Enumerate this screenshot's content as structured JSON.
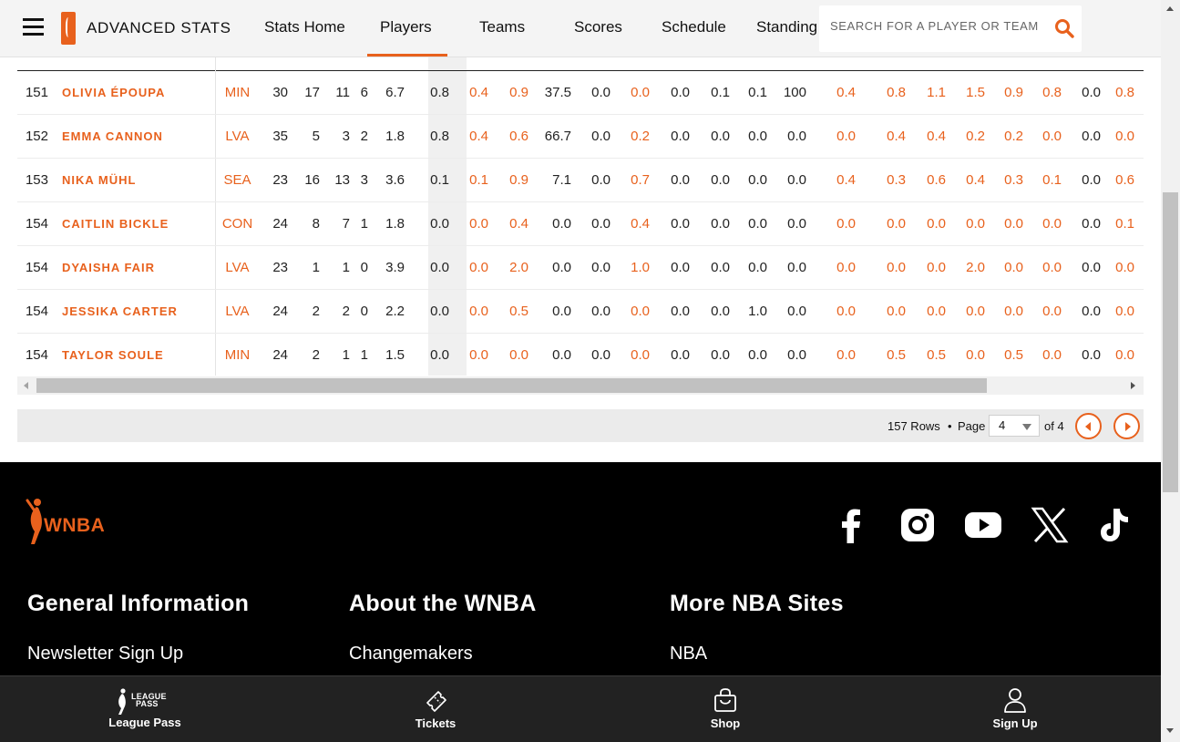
{
  "header": {
    "title": "ADVANCED STATS",
    "nav": [
      {
        "label": "Stats Home",
        "name": "nav-stats-home"
      },
      {
        "label": "Players",
        "name": "nav-players"
      },
      {
        "label": "Teams",
        "name": "nav-teams"
      },
      {
        "label": "Scores",
        "name": "nav-scores"
      },
      {
        "label": "Schedule",
        "name": "nav-schedule"
      },
      {
        "label": "Standing",
        "name": "nav-standings"
      }
    ],
    "active_nav": "Players",
    "search_placeholder": "SEARCH FOR A PLAYER OR TEAM"
  },
  "colors": {
    "accent": "#e8611d",
    "footer_bg": "#000000",
    "bottom_bar_bg": "#222222"
  },
  "table": {
    "rows": [
      {
        "rank": "151",
        "player": "OLIVIA ÉPOUPA",
        "team": "MIN",
        "stats": [
          "30",
          "17",
          "11",
          "6",
          "6.7",
          "0.8",
          "0.4",
          "0.9",
          "37.5",
          "0.0",
          "0.0",
          "0.0",
          "0.1",
          "0.1",
          "100",
          "0.4",
          "0.8",
          "1.1",
          "1.5",
          "0.9",
          "0.8",
          "0.0",
          "0.8"
        ]
      },
      {
        "rank": "152",
        "player": "EMMA CANNON",
        "team": "LVA",
        "stats": [
          "35",
          "5",
          "3",
          "2",
          "1.8",
          "0.8",
          "0.4",
          "0.6",
          "66.7",
          "0.0",
          "0.2",
          "0.0",
          "0.0",
          "0.0",
          "0.0",
          "0.0",
          "0.4",
          "0.4",
          "0.2",
          "0.2",
          "0.0",
          "0.0",
          "0.0"
        ]
      },
      {
        "rank": "153",
        "player": "NIKA MÜHL",
        "team": "SEA",
        "stats": [
          "23",
          "16",
          "13",
          "3",
          "3.6",
          "0.1",
          "0.1",
          "0.9",
          "7.1",
          "0.0",
          "0.7",
          "0.0",
          "0.0",
          "0.0",
          "0.0",
          "0.4",
          "0.3",
          "0.6",
          "0.4",
          "0.3",
          "0.1",
          "0.0",
          "0.6"
        ]
      },
      {
        "rank": "154",
        "player": "CAITLIN BICKLE",
        "team": "CON",
        "stats": [
          "24",
          "8",
          "7",
          "1",
          "1.8",
          "0.0",
          "0.0",
          "0.4",
          "0.0",
          "0.0",
          "0.4",
          "0.0",
          "0.0",
          "0.0",
          "0.0",
          "0.0",
          "0.0",
          "0.0",
          "0.0",
          "0.0",
          "0.0",
          "0.0",
          "0.1"
        ]
      },
      {
        "rank": "154",
        "player": "DYAISHA FAIR",
        "team": "LVA",
        "stats": [
          "23",
          "1",
          "1",
          "0",
          "3.9",
          "0.0",
          "0.0",
          "2.0",
          "0.0",
          "0.0",
          "1.0",
          "0.0",
          "0.0",
          "0.0",
          "0.0",
          "0.0",
          "0.0",
          "0.0",
          "2.0",
          "0.0",
          "0.0",
          "0.0",
          "0.0"
        ]
      },
      {
        "rank": "154",
        "player": "JESSIKA CARTER",
        "team": "LVA",
        "stats": [
          "24",
          "2",
          "2",
          "0",
          "2.2",
          "0.0",
          "0.0",
          "0.5",
          "0.0",
          "0.0",
          "0.0",
          "0.0",
          "0.0",
          "1.0",
          "0.0",
          "0.0",
          "0.0",
          "0.0",
          "0.0",
          "0.0",
          "0.0",
          "0.0",
          "0.0"
        ]
      },
      {
        "rank": "154",
        "player": "TAYLOR SOULE",
        "team": "MIN",
        "stats": [
          "24",
          "2",
          "1",
          "1",
          "1.5",
          "0.0",
          "0.0",
          "0.0",
          "0.0",
          "0.0",
          "0.0",
          "0.0",
          "0.0",
          "0.0",
          "0.0",
          "0.0",
          "0.5",
          "0.5",
          "0.0",
          "0.5",
          "0.0",
          "0.0",
          "0.0"
        ]
      }
    ]
  },
  "pagination": {
    "rows_text": "157 Rows",
    "bullet": "•",
    "page_label": "Page",
    "current_page": "4",
    "of_text": "of 4"
  },
  "footer": {
    "logo_text": "WNBA",
    "social": [
      {
        "name": "facebook-icon"
      },
      {
        "name": "instagram-icon"
      },
      {
        "name": "youtube-icon"
      },
      {
        "name": "x-icon"
      },
      {
        "name": "tiktok-icon"
      }
    ],
    "columns": [
      {
        "heading": "General Information",
        "first_link": "Newsletter Sign Up"
      },
      {
        "heading": "About the WNBA",
        "first_link": "Changemakers"
      },
      {
        "heading": "More NBA Sites",
        "first_link": "NBA"
      }
    ]
  },
  "bottom_bar": {
    "league_pass_logo_line1": "LEAGUE",
    "league_pass_logo_line2": "PASS",
    "items": [
      {
        "label": "League Pass",
        "icon": "league-pass-icon"
      },
      {
        "label": "Tickets",
        "icon": "ticket-icon"
      },
      {
        "label": "Shop",
        "icon": "shopping-bag-icon"
      },
      {
        "label": "Sign Up",
        "icon": "user-icon"
      }
    ]
  }
}
